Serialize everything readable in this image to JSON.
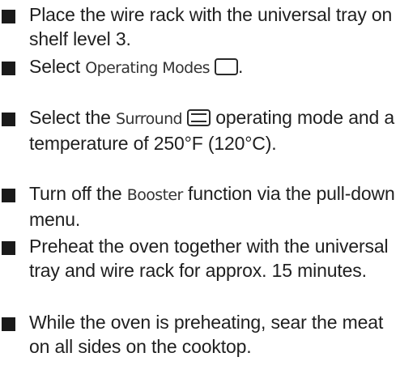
{
  "steps": [
    {
      "parts": {
        "text": "Place the wire rack with the universal tray on shelf level 3."
      }
    },
    {
      "parts": {
        "before": "Select ",
        "ui": "Operating Modes",
        "icon": "operating-modes-icon",
        "after": "."
      }
    },
    {
      "parts": {
        "before": "Select the ",
        "ui": "Surround",
        "icon": "surround-heat-icon",
        "after": " operating mode and a temperature of 250°F (120°C)."
      }
    },
    {
      "parts": {
        "before": "Turn off the ",
        "ui": "Booster",
        "after": " function via the pull-down menu."
      }
    },
    {
      "parts": {
        "text": "Preheat the oven together with the universal tray and wire rack for approx. 15 minutes."
      }
    },
    {
      "parts": {
        "text": "While the oven is preheating, sear the meat on all sides on the cooktop."
      }
    }
  ]
}
